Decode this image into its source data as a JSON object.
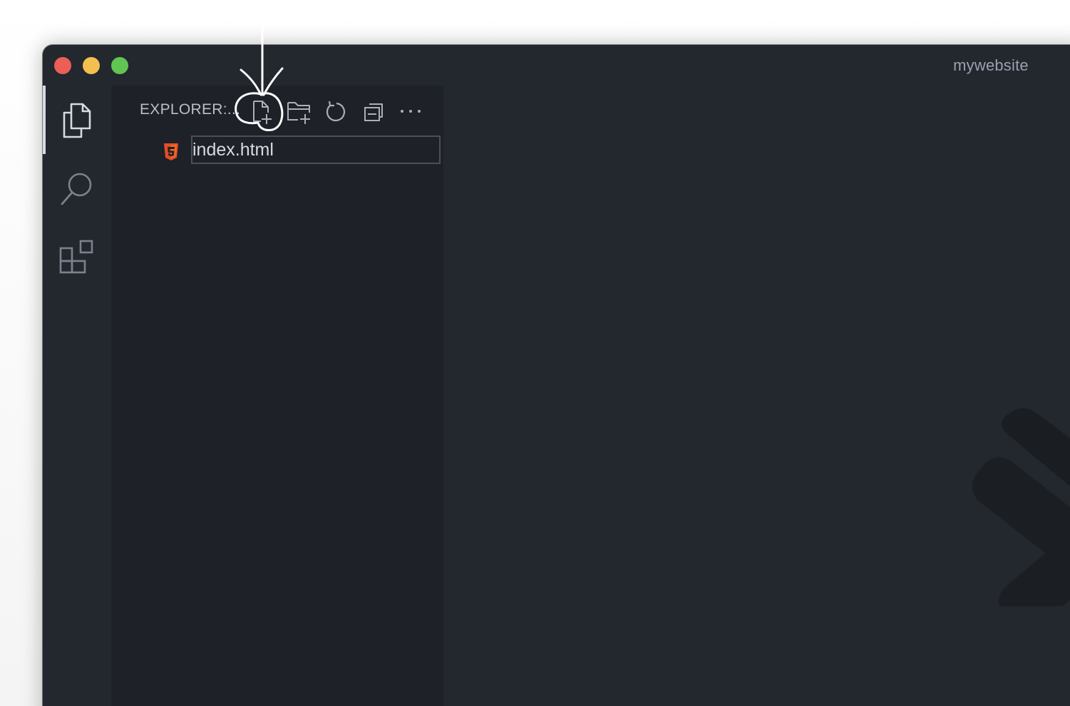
{
  "window": {
    "title": "mywebsite"
  },
  "activity_bar": {
    "items": [
      {
        "name": "explorer",
        "icon": "files-icon",
        "active": true
      },
      {
        "name": "search",
        "icon": "search-icon",
        "active": false
      },
      {
        "name": "extensions",
        "icon": "extensions-icon",
        "active": false
      }
    ]
  },
  "sidebar": {
    "header": "EXPLORER:...",
    "toolbar": {
      "icons": [
        "new-file-icon",
        "new-folder-icon",
        "refresh-icon",
        "collapse-all-icon",
        "more-actions-icon"
      ]
    },
    "new_file": {
      "icon": "html5-icon",
      "value": "index.html"
    }
  },
  "colors": {
    "editor_bg": "#23272e",
    "sidebar_bg": "#1e2127",
    "html5_icon": "#e44d26",
    "close": "#ec5f56",
    "minimize": "#f4bf4f",
    "maximize": "#61c554"
  }
}
